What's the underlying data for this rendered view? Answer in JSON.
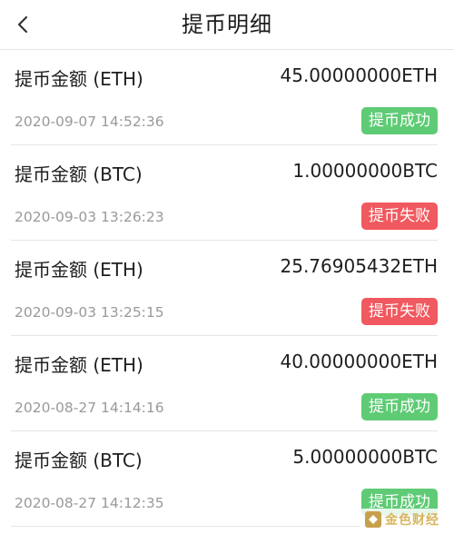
{
  "header": {
    "title": "提币明细",
    "back_icon": "chevron-left-icon"
  },
  "colors": {
    "success": "#5fcb75",
    "failure": "#f0595f",
    "divider": "#e6e6e6",
    "time_text": "#9a9a9a"
  },
  "records": [
    {
      "label": "提币金额 (ETH)",
      "amount": "45.00000000ETH",
      "time": "2020-09-07 14:52:36",
      "status": "提币成功",
      "status_type": "ok"
    },
    {
      "label": "提币金额 (BTC)",
      "amount": "1.00000000BTC",
      "time": "2020-09-03 13:26:23",
      "status": "提币失败",
      "status_type": "fail"
    },
    {
      "label": "提币金额 (ETH)",
      "amount": "25.76905432ETH",
      "time": "2020-09-03 13:25:15",
      "status": "提币失败",
      "status_type": "fail"
    },
    {
      "label": "提币金额 (ETH)",
      "amount": "40.00000000ETH",
      "time": "2020-08-27 14:14:16",
      "status": "提币成功",
      "status_type": "ok"
    },
    {
      "label": "提币金额 (BTC)",
      "amount": "5.00000000BTC",
      "time": "2020-08-27 14:12:35",
      "status": "提币成功",
      "status_type": "ok"
    }
  ],
  "watermark": {
    "text": "金色财经"
  }
}
